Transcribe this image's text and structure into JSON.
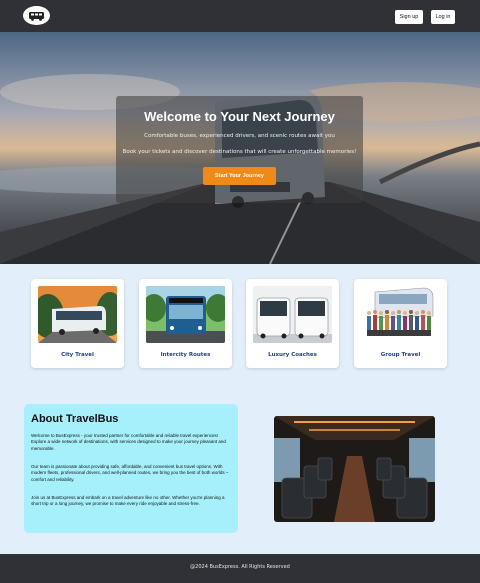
{
  "header": {
    "logo_icon": "bus-logo-icon",
    "signup_label": "Sign up",
    "login_label": "Log in"
  },
  "hero": {
    "title": "Welcome to Your Next Journey",
    "subtitle": "Comfortable buses, experienced drivers, and scenic routes await you",
    "description": "Book your tickets and discover destinations that will create unforgettable memories!",
    "cta_label": "Start Your Journey",
    "cta_color": "#f08a17"
  },
  "services": [
    {
      "label": "City Travel"
    },
    {
      "label": "Intercity Routes"
    },
    {
      "label": "Luxury Coaches"
    },
    {
      "label": "Group Travel"
    }
  ],
  "about": {
    "title": "About TravelBus",
    "paragraph1": "Welcome to BusExpress - your trusted partner for comfortable and reliable travel experiences! Explore a wide network of destinations, with services designed to make your journey pleasant and memorable.",
    "paragraph2": "Our team is passionate about providing safe, affordable, and convenient bus travel options. With modern fleets, professional drivers, and well-planned routes, we bring you the best of both worlds – comfort and reliability.",
    "paragraph3": "Join us at BusExpress and embark on a travel adventure like no other. Whether you're planning a short trip or a long journey, we promise to make every ride enjoyable and stress-free."
  },
  "footer": {
    "copyright": "@2024 BusExpress. All Rights Reserved"
  },
  "colors": {
    "header_bg": "#2f3136",
    "page_bg": "#e3eefb",
    "about_bg": "#a6f0fb",
    "service_label": "#1e3f8a"
  }
}
